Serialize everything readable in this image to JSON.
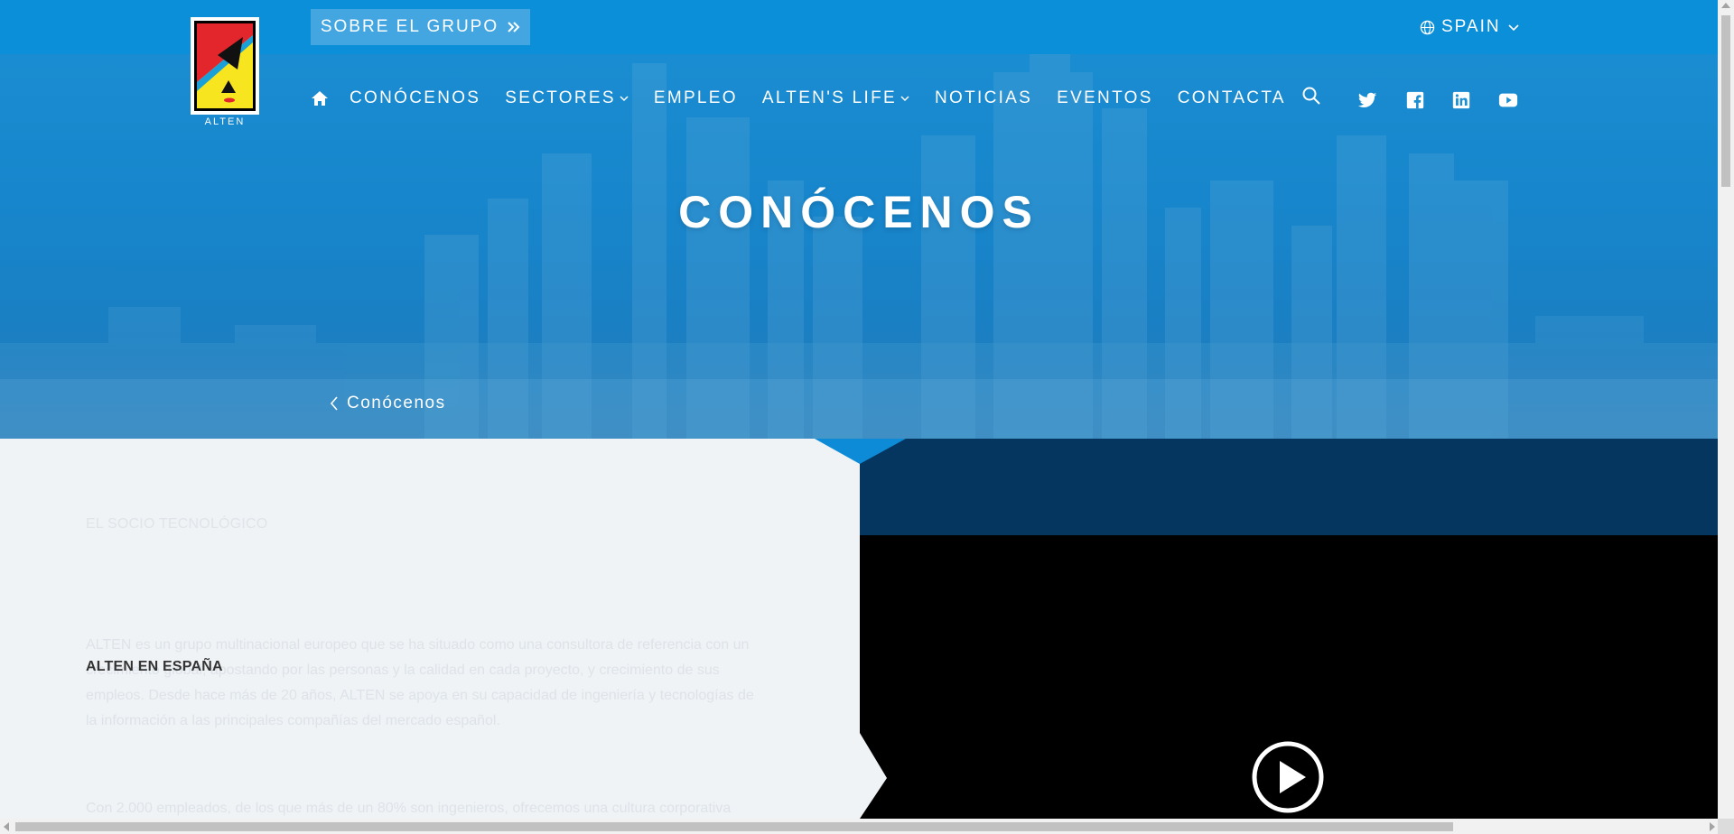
{
  "header": {
    "logo_text": "ALTEN",
    "group_button_label": "SOBRE EL GRUPO",
    "language_label": "SPAIN"
  },
  "nav": {
    "items": [
      {
        "label": "CONÓCENOS",
        "has_dropdown": false
      },
      {
        "label": "SECTORES",
        "has_dropdown": true
      },
      {
        "label": "EMPLEO",
        "has_dropdown": false
      },
      {
        "label": "ALTEN'S LIFE",
        "has_dropdown": true
      },
      {
        "label": "NOTICIAS",
        "has_dropdown": false
      },
      {
        "label": "EVENTOS",
        "has_dropdown": false
      },
      {
        "label": "CONTACTA",
        "has_dropdown": false
      }
    ],
    "icons": [
      "home-icon",
      "search-icon",
      "twitter-icon",
      "facebook-icon",
      "linkedin-icon",
      "youtube-icon"
    ]
  },
  "hero": {
    "title": "CONÓCENOS",
    "breadcrumb": "Conócenos"
  },
  "content": {
    "kicker": "EL SOCIO TECNOLÓGICO",
    "section_heading": "ALTEN EN ESPAÑA",
    "paragraph_1": "ALTEN es un grupo multinacional europeo que se ha situado como una consultora de referencia con un crecimiento global, apostando por las personas y la calidad en cada proyecto, y crecimiento de sus empleos. Desde hace más de 20 años, ALTEN se apoya en su capacidad de ingeniería y tecnologías de la información a las principales compañías del mercado español.",
    "paragraph_2": "Con 2.000 empleados, de los que más de un 80% son ingenieros, ofrecemos una cultura corporativa"
  },
  "video": {
    "play_icon": "play-icon"
  },
  "colors": {
    "topbar": "#0a8fd8",
    "hero_blue": "#1786cc",
    "group_button": "#44a6e0",
    "dark_navy": "#04365f",
    "light_bg": "#f0f3f6"
  }
}
